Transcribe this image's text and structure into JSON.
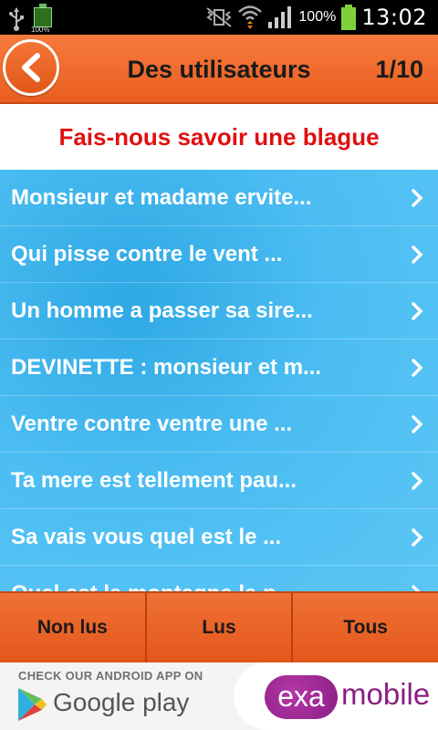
{
  "status_bar": {
    "battery_small_label": "100%",
    "battery_percent": "100%",
    "time": "13:02"
  },
  "header": {
    "title": "Des utilisateurs",
    "page_count": "1/10"
  },
  "subtitle": "Fais-nous savoir une blague",
  "list": {
    "items": [
      "Monsieur et madame ervite...",
      "Qui pisse contre le vent ...",
      "Un homme a passer sa sire...",
      "DEVINETTE : monsieur et m...",
      "Ventre contre ventre une ...",
      "Ta mere est tellement pau...",
      "Sa vais vous quel est le ...",
      "Quel est la montagne la p..."
    ]
  },
  "tabs": [
    "Non lus",
    "Lus",
    "Tous"
  ],
  "ad": {
    "check_text": "CHECK OUR ANDROID APP ON",
    "store_text": "Google play",
    "brand_prefix": "exa",
    "brand_suffix": "mobile"
  },
  "colors": {
    "header_orange": "#ea5f21",
    "subtitle_red": "#e01010",
    "list_blue": "#4bbdf2",
    "brand_purple": "#8a1e82"
  }
}
